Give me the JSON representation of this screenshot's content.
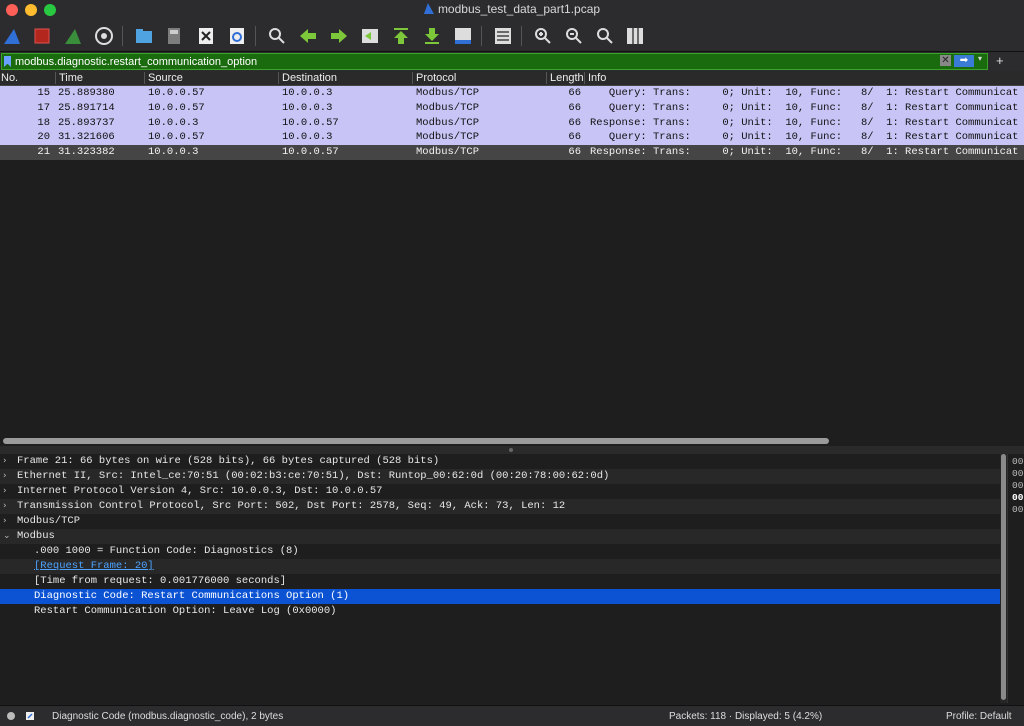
{
  "window": {
    "title": "modbus_test_data_part1.pcap"
  },
  "toolbar": {
    "icons": [
      "shark-fin-start-icon",
      "stop-capture-icon",
      "restart-capture-icon",
      "capture-options-icon",
      "open-file-icon",
      "save-file-icon",
      "close-file-icon",
      "reload-file-icon",
      "find-packet-icon",
      "go-back-icon",
      "go-forward-icon",
      "go-to-packet-icon",
      "go-first-icon",
      "go-last-icon",
      "autoscroll-icon",
      "colorize-icon",
      "zoom-in-icon",
      "zoom-out-icon",
      "normal-size-icon",
      "resize-columns-icon"
    ]
  },
  "filter": {
    "value": "modbus.diagnostic.restart_communication_option",
    "clear_label": "✕",
    "apply_label": "➡",
    "dropdown_label": "▾",
    "add_label": "+",
    "color": "#1a6b0e"
  },
  "packet_list": {
    "columns": [
      "No.",
      "Time",
      "Source",
      "Destination",
      "Protocol",
      "Length",
      "Info"
    ],
    "rows": [
      {
        "no": "15",
        "time": "25.889380",
        "src": "10.0.0.57",
        "dst": "10.0.0.3",
        "proto": "Modbus/TCP",
        "len": "66",
        "info": "   Query: Trans:     0; Unit:  10, Func:   8/  1: Restart Communicat"
      },
      {
        "no": "17",
        "time": "25.891714",
        "src": "10.0.0.57",
        "dst": "10.0.0.3",
        "proto": "Modbus/TCP",
        "len": "66",
        "info": "   Query: Trans:     0; Unit:  10, Func:   8/  1: Restart Communicat"
      },
      {
        "no": "18",
        "time": "25.893737",
        "src": "10.0.0.3",
        "dst": "10.0.0.57",
        "proto": "Modbus/TCP",
        "len": "66",
        "info": "Response: Trans:     0; Unit:  10, Func:   8/  1: Restart Communicat"
      },
      {
        "no": "20",
        "time": "31.321606",
        "src": "10.0.0.57",
        "dst": "10.0.0.3",
        "proto": "Modbus/TCP",
        "len": "66",
        "info": "   Query: Trans:     0; Unit:  10, Func:   8/  1: Restart Communicat"
      },
      {
        "no": "21",
        "time": "31.323382",
        "src": "10.0.0.3",
        "dst": "10.0.0.57",
        "proto": "Modbus/TCP",
        "len": "66",
        "info": "Response: Trans:     0; Unit:  10, Func:   8/  1: Restart Communicat"
      }
    ],
    "row_color": "#c8c4f6",
    "selected_row_color": "#454545"
  },
  "details": {
    "lines": [
      {
        "arrow": "›",
        "text": "Frame 21: 66 bytes on wire (528 bits), 66 bytes captured (528 bits)"
      },
      {
        "arrow": "›",
        "text": "Ethernet II, Src: Intel_ce:70:51 (00:02:b3:ce:70:51), Dst: Runtop_00:62:0d (00:20:78:00:62:0d)"
      },
      {
        "arrow": "›",
        "text": "Internet Protocol Version 4, Src: 10.0.0.3, Dst: 10.0.0.57"
      },
      {
        "arrow": "›",
        "text": "Transmission Control Protocol, Src Port: 502, Dst Port: 2578, Seq: 49, Ack: 73, Len: 12"
      },
      {
        "arrow": "›",
        "text": "Modbus/TCP"
      },
      {
        "arrow": "⌄",
        "text": "Modbus"
      },
      {
        "arrow": "",
        "text": ".000 1000 = Function Code: Diagnostics (8)"
      },
      {
        "arrow": "",
        "text": "[Request Frame: 20]"
      },
      {
        "arrow": "",
        "text": "[Time from request: 0.001776000 seconds]"
      },
      {
        "arrow": "",
        "text": "Diagnostic Code: Restart Communications Option (1)"
      },
      {
        "arrow": "",
        "text": "Restart Communication Option: Leave Log (0x0000)"
      }
    ],
    "highlight_color": "#0b53d3"
  },
  "bytes_pane": {
    "lines": [
      "00",
      "00",
      "00",
      "00",
      "00"
    ]
  },
  "status": {
    "field_info": "Diagnostic Code (modbus.diagnostic_code), 2 bytes",
    "packets": "Packets: 118 · Displayed: 5 (4.2%)",
    "profile": "Profile: Default"
  }
}
